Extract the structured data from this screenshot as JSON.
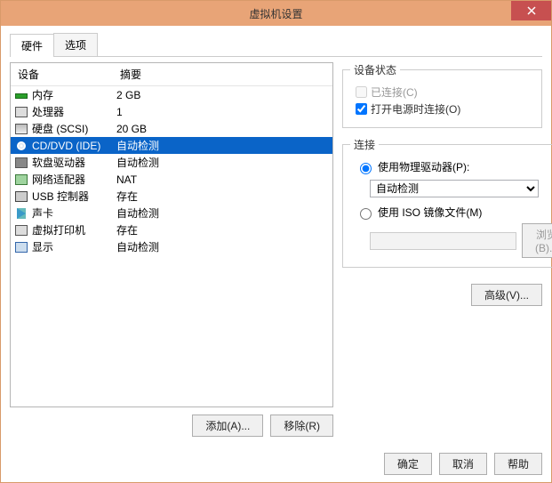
{
  "window": {
    "title": "虚拟机设置"
  },
  "tabs": {
    "hardware": "硬件",
    "options": "选项"
  },
  "hwlist": {
    "header_device": "设备",
    "header_summary": "摘要",
    "rows": [
      {
        "device": "内存",
        "summary": "2 GB",
        "icon": "mem"
      },
      {
        "device": "处理器",
        "summary": "1",
        "icon": "cpu"
      },
      {
        "device": "硬盘 (SCSI)",
        "summary": "20 GB",
        "icon": "hdd"
      },
      {
        "device": "CD/DVD (IDE)",
        "summary": "自动检测",
        "icon": "cd",
        "selected": true
      },
      {
        "device": "软盘驱动器",
        "summary": "自动检测",
        "icon": "fd"
      },
      {
        "device": "网络适配器",
        "summary": "NAT",
        "icon": "net"
      },
      {
        "device": "USB 控制器",
        "summary": "存在",
        "icon": "usb"
      },
      {
        "device": "声卡",
        "summary": "自动检测",
        "icon": "snd"
      },
      {
        "device": "虚拟打印机",
        "summary": "存在",
        "icon": "prn"
      },
      {
        "device": "显示",
        "summary": "自动检测",
        "icon": "disp"
      }
    ]
  },
  "left_buttons": {
    "add": "添加(A)...",
    "remove": "移除(R)"
  },
  "right": {
    "status_group": "设备状态",
    "connected": "已连接(C)",
    "connect_at_poweron": "打开电源时连接(O)",
    "connection_group": "连接",
    "use_physical": "使用物理驱动器(P):",
    "physical_option": "自动检测",
    "use_iso": "使用 ISO 镜像文件(M)",
    "browse": "浏览(B)...",
    "advanced": "高级(V)..."
  },
  "bottom": {
    "ok": "确定",
    "cancel": "取消",
    "help": "帮助"
  }
}
